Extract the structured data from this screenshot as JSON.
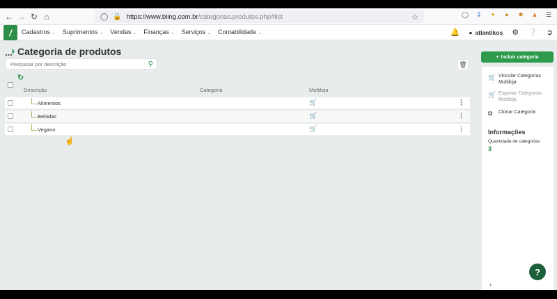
{
  "browser": {
    "url_host": "https://www.bling.com.br",
    "url_path": "/categorias.produtos.php#list"
  },
  "header": {
    "logo_text": "/",
    "menu": [
      {
        "label": "Cadastros"
      },
      {
        "label": "Suprimentos"
      },
      {
        "label": "Vendas"
      },
      {
        "label": "Finanças"
      },
      {
        "label": "Serviços"
      },
      {
        "label": "Contabilidade"
      }
    ],
    "user": "atlantikos"
  },
  "page": {
    "breadcrumb_dots": "...",
    "title": "Categoria de produtos",
    "search_placeholder": "Pesquisar por descrição"
  },
  "table": {
    "columns": [
      "Descrição",
      "Categoria",
      "Multiloja"
    ],
    "rows": [
      {
        "descricao": "Alimentos"
      },
      {
        "descricao": "Bebidas"
      },
      {
        "descricao": "Vegano"
      }
    ]
  },
  "sidebar": {
    "add_button": "Incluir categoria",
    "actions": [
      {
        "label": "Vincular Categorias Multiloja",
        "enabled": true
      },
      {
        "label": "Exportar Categorias Multiloja",
        "enabled": false
      },
      {
        "label": "Clonar Categoria",
        "enabled": true
      }
    ],
    "info_title": "Informações",
    "info_label": "Quantidade de categorias",
    "info_value": "3"
  },
  "colors": {
    "brand_green": "#2d8f48",
    "fab_green": "#1e5f3b"
  },
  "help_label": "?"
}
